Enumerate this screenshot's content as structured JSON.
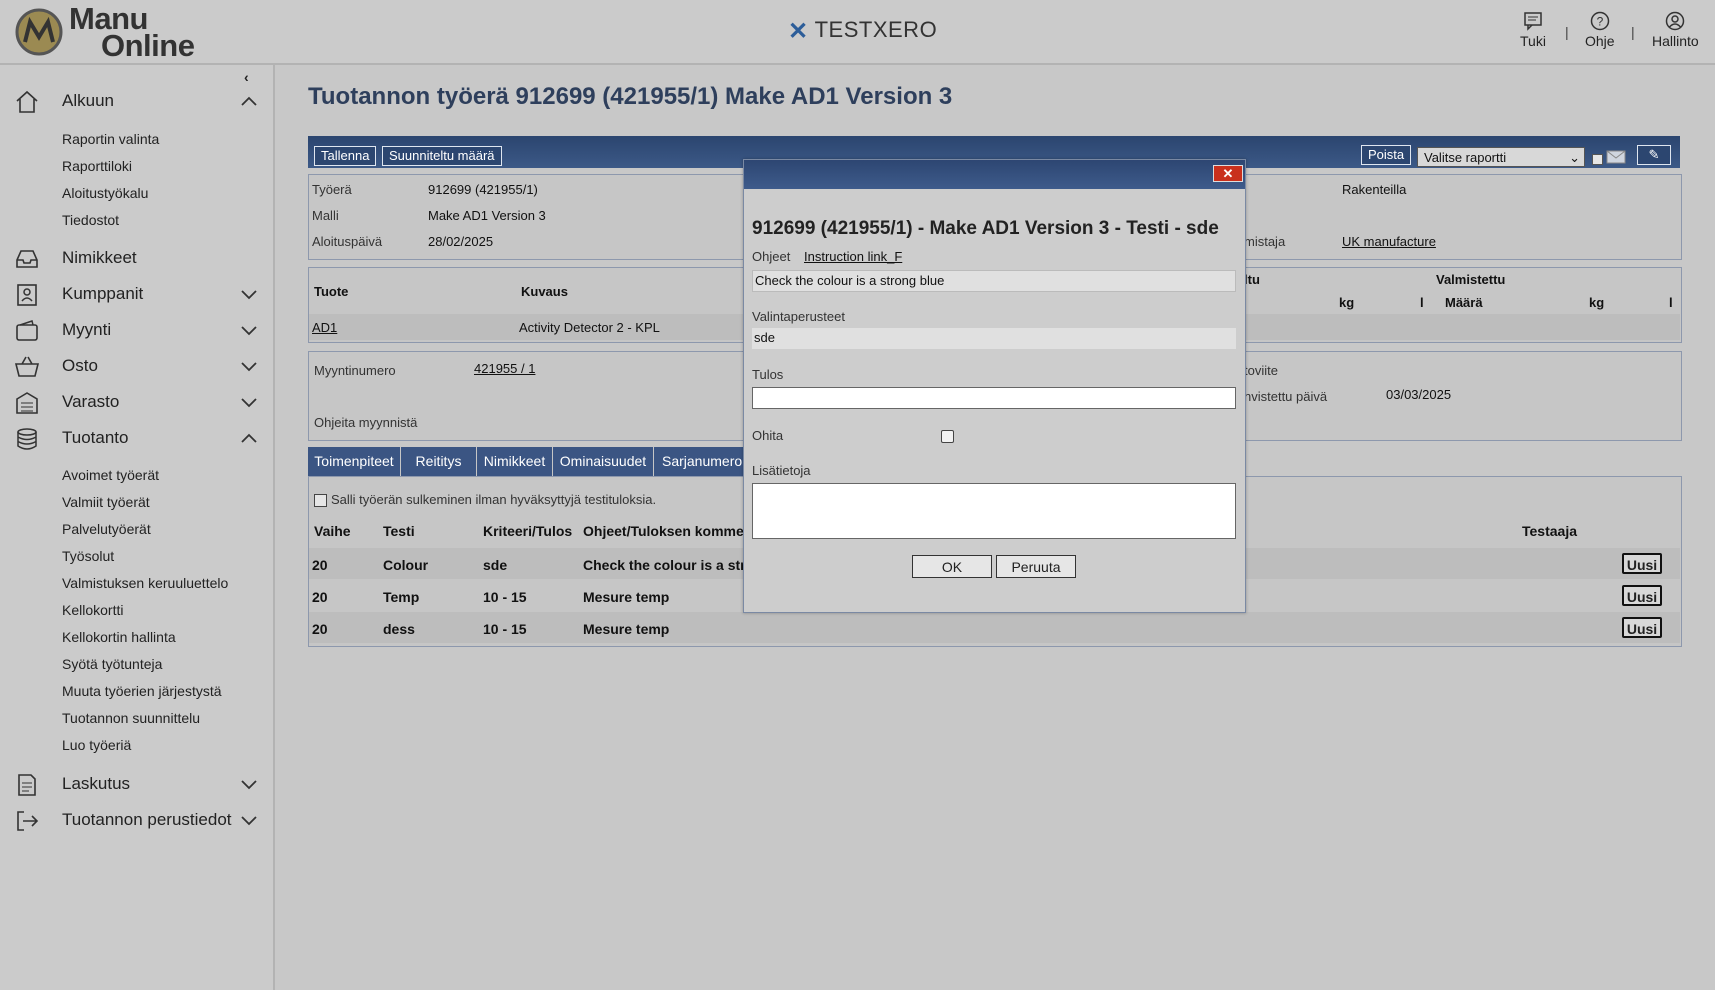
{
  "header": {
    "logo_line1": "Manu",
    "logo_line2": "Online",
    "environment": "TESTXERO",
    "env_icon": "x-star-icon",
    "buttons": [
      {
        "label": "Tuki",
        "icon": "chat-icon"
      },
      {
        "label": "Ohje",
        "icon": "help-icon"
      },
      {
        "label": "Hallinto",
        "icon": "user-icon"
      }
    ],
    "separator": "|"
  },
  "sidebar": {
    "collapse_icon": "chevron-left-icon",
    "menus": [
      {
        "label": "Alkuun",
        "icon": "home-icon",
        "expanded": true,
        "items": [
          "Raportin valinta",
          "Raporttiloki",
          "Aloitustyökalu",
          "Tiedostot"
        ]
      },
      {
        "label": "Nimikkeet",
        "icon": "inbox-icon"
      },
      {
        "label": "Kumppanit",
        "icon": "contact-icon",
        "expanded": false
      },
      {
        "label": "Myynti",
        "icon": "wallet-icon",
        "expanded": false
      },
      {
        "label": "Osto",
        "icon": "basket-icon",
        "expanded": false
      },
      {
        "label": "Varasto",
        "icon": "warehouse-icon",
        "expanded": false
      },
      {
        "label": "Tuotanto",
        "icon": "database-icon",
        "expanded": true,
        "items": [
          "Avoimet työerät",
          "Valmiit työerät",
          "Palvelutyöerät",
          "Työsolut",
          "Valmistuksen keruuluettelo",
          "Kellokortti",
          "Kellokortin hallinta",
          "Syötä työtunteja",
          "Muuta työerien järjestystä",
          "Tuotannon suunnittelu",
          "Luo työeriä"
        ]
      },
      {
        "label": "Laskutus",
        "icon": "document-icon",
        "expanded": false
      },
      {
        "label": "Tuotannon perustiedot",
        "icon": "exit-icon",
        "expanded": false
      }
    ]
  },
  "page": {
    "title": "Tuotannon työerä 912699 (421955/1) Make AD1 Version 3",
    "toolbar": {
      "save": "Tallenna",
      "planned_qty": "Suunniteltu määrä",
      "delete": "Poista",
      "report_select": "Valitse raportti",
      "mail_icon": "mail-icon",
      "attach_icon": "paperclip-icon"
    },
    "info": {
      "batch_label": "Työerä",
      "batch_value": "912699 (421955/1)",
      "model_label": "Malli",
      "model_value": "Make AD1 Version 3",
      "start_label": "Aloituspäivä",
      "start_value": "28/02/2025",
      "status_value": "Rakenteilla",
      "maker_label_partial": "mistaja",
      "maker_value": "UK manufacture"
    },
    "product_table": {
      "col_product": "Tuote",
      "col_desc": "Kuvaus",
      "col_partial": "ltu",
      "col_made": "Valmistettu",
      "sub_kg": "kg",
      "sub_l": "l",
      "sub_qty": "Määrä",
      "product": "AD1",
      "desc": "Activity Detector 2 - KPL"
    },
    "sales": {
      "order_label": "Myyntinumero",
      "order_value": "421955 / 1",
      "instructions_label": "Ohjeita myynnistä",
      "ref_label_partial": "toviite",
      "date_label_partial": "nvistettu päivä",
      "date_value": "03/03/2025"
    },
    "tabs": [
      "Toimenpiteet",
      "Reititys",
      "Nimikkeet",
      "Ominaisuudet",
      "Sarjanumero"
    ],
    "tests": {
      "allow_label": "Salli työerän sulkeminen ilman hyväksyttyjä testituloksia.",
      "cols": {
        "phase": "Vaihe",
        "test": "Testi",
        "criteria": "Kriteeri/Tulos",
        "instr": "Ohjeet/Tuloksen kommen",
        "tester": "Testaaja"
      },
      "new_label": "Uusi",
      "rows": [
        {
          "phase": "20",
          "test": "Colour",
          "criteria": "sde",
          "instr": "Check the colour is a stro"
        },
        {
          "phase": "20",
          "test": "Temp",
          "criteria": "10 - 15",
          "instr": "Mesure temp"
        },
        {
          "phase": "20",
          "test": "dess",
          "criteria": "10 - 15",
          "instr": "Mesure temp"
        }
      ]
    }
  },
  "dialog": {
    "close": "✕",
    "title": "912699 (421955/1) - Make AD1 Version 3 - Testi - sde",
    "instr_label": "Ohjeet",
    "instr_link": "Instruction link_F",
    "instr_text": "Check the colour is a strong blue",
    "criteria_label": "Valintaperusteet",
    "criteria_value": "sde",
    "result_label": "Tulos",
    "result_value": "",
    "skip_label": "Ohita",
    "extra_label": "Lisätietoja",
    "ok": "OK",
    "cancel": "Peruuta"
  }
}
